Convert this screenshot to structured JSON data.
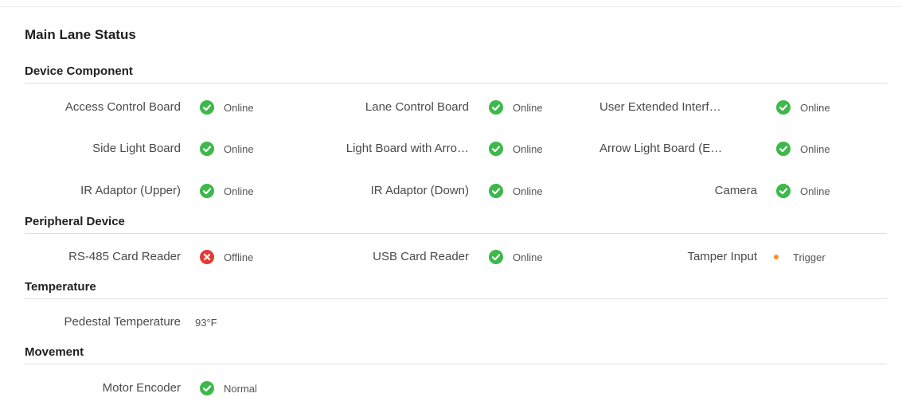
{
  "title": "Main Lane Status",
  "colors": {
    "online": "#3db84a",
    "offline": "#e53935",
    "trigger": "#ff8a1f"
  },
  "sections": {
    "device_component": {
      "heading": "Device Component",
      "items": [
        {
          "label": "Access Control Board",
          "status": "Online",
          "icon": "check-circle-icon"
        },
        {
          "label": "Lane Control Board",
          "status": "Online",
          "icon": "check-circle-icon"
        },
        {
          "label": "User Extended Interf…",
          "status": "Online",
          "icon": "check-circle-icon"
        },
        {
          "label": "Side Light Board",
          "status": "Online",
          "icon": "check-circle-icon"
        },
        {
          "label": "Light Board with Arro…",
          "status": "Online",
          "icon": "check-circle-icon"
        },
        {
          "label": "Arrow Light Board (E…",
          "status": "Online",
          "icon": "check-circle-icon"
        },
        {
          "label": "IR Adaptor (Upper)",
          "status": "Online",
          "icon": "check-circle-icon"
        },
        {
          "label": "IR Adaptor (Down)",
          "status": "Online",
          "icon": "check-circle-icon"
        },
        {
          "label": "Camera",
          "status": "Online",
          "icon": "check-circle-icon"
        }
      ]
    },
    "peripheral_device": {
      "heading": "Peripheral Device",
      "items": [
        {
          "label": "RS-485 Card Reader",
          "status": "Offline",
          "icon": "error-circle-icon"
        },
        {
          "label": "USB Card Reader",
          "status": "Online",
          "icon": "check-circle-icon"
        },
        {
          "label": "Tamper Input",
          "status": "Trigger",
          "icon": "dot-icon"
        }
      ]
    },
    "temperature": {
      "heading": "Temperature",
      "items": [
        {
          "label": "Pedestal Temperature",
          "value": "93°F"
        }
      ]
    },
    "movement": {
      "heading": "Movement",
      "items": [
        {
          "label": "Motor Encoder",
          "status": "Normal",
          "icon": "check-circle-icon"
        }
      ]
    }
  }
}
